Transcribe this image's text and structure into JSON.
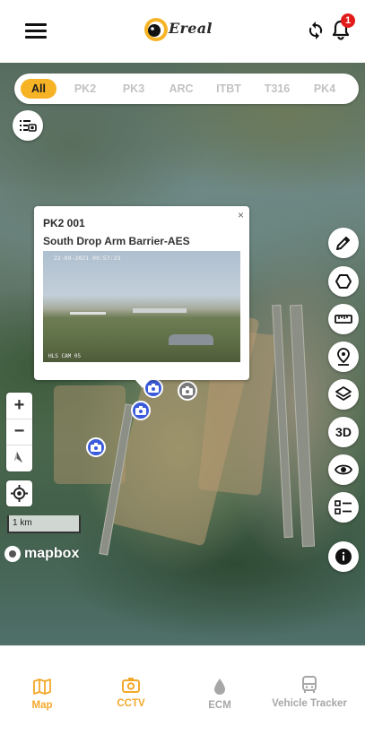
{
  "header": {
    "logo_text": "Ereal",
    "notification_count": "1"
  },
  "filters": {
    "items": [
      "All",
      "PK2",
      "PK3",
      "ARC",
      "ITBT",
      "T316",
      "PK4"
    ],
    "active": "All"
  },
  "popup": {
    "title": "PK2 001",
    "subtitle": "South Drop Arm Barrier-AES",
    "image_timestamp": "22-09-2021 09:57:23",
    "image_camera_label": "HLS CAM 05",
    "close": "×"
  },
  "map_controls": {
    "zoom_in": "+",
    "zoom_out": "−",
    "three_d": "3D",
    "scale": "1 km",
    "attribution": "mapbox"
  },
  "right_tools": [
    "pencil-icon",
    "hexagon-icon",
    "ruler-icon",
    "map-pin-icon",
    "layers-icon",
    "3d-toggle",
    "eye-icon",
    "list-icon",
    "info-icon"
  ],
  "bottom_nav": {
    "items": [
      {
        "label": "Map",
        "icon": "map-icon",
        "color": "#f4a82a"
      },
      {
        "label": "CCTV",
        "icon": "camera-icon",
        "color": "#f4a82a"
      },
      {
        "label": "ECM",
        "icon": "drop-icon",
        "color": "#a7a7a7"
      },
      {
        "label": "Vehicle Tracker",
        "icon": "bus-icon",
        "color": "#a7a7a7"
      }
    ]
  },
  "colors": {
    "accent": "#f6b326",
    "marker_blue": "#3b5bdb",
    "badge_red": "#e21b1b"
  }
}
